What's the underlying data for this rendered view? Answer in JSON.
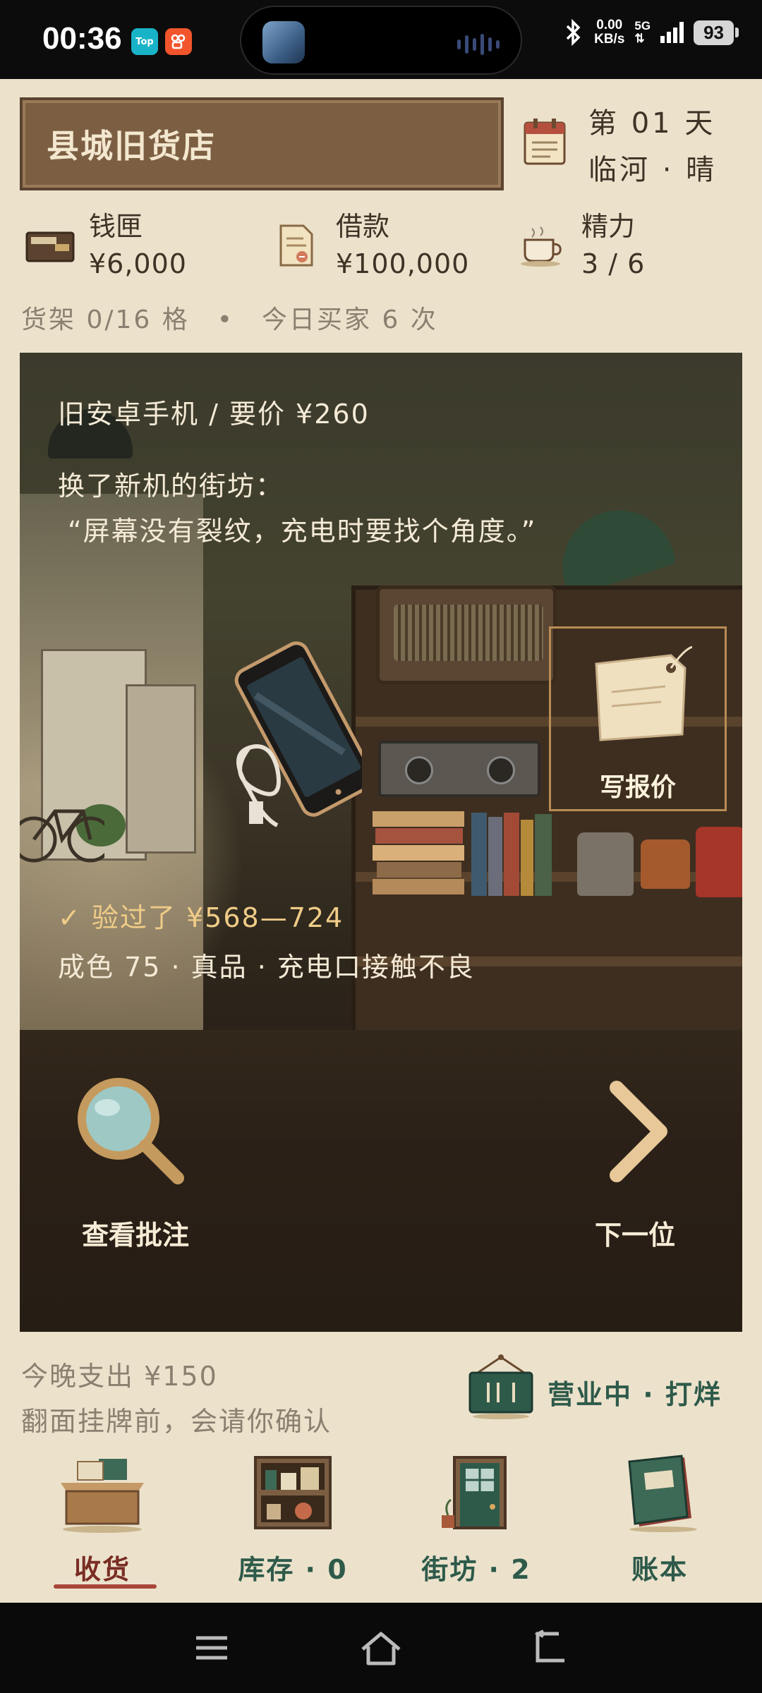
{
  "status_bar": {
    "time": "00:36",
    "app1_label": "Top",
    "net_speed": "0.00",
    "net_unit": "KB/s",
    "network": "5G",
    "battery": "93"
  },
  "header": {
    "shop_name": "县城旧货店",
    "day": "第 01 天",
    "location_weather": "临河 · 晴"
  },
  "stats": [
    {
      "label": "钱匣",
      "value": "¥6,000",
      "icon": "wallet-icon"
    },
    {
      "label": "借款",
      "value": "¥100,000",
      "icon": "loan-document-icon"
    },
    {
      "label": "精力",
      "value": "3 / 6",
      "icon": "coffee-cup-icon"
    }
  ],
  "shelf_info": "货架 0/16 格　•　今日买家 6 次",
  "scene": {
    "item_title": "旧安卓手机 / 要价 ¥260",
    "seller": "换了新机的街坊：",
    "quote": "“屏幕没有裂纹，充电时要找个角度。”",
    "quote_button": "写报价",
    "verified": "✓ 验过了 ¥568—724",
    "condition": "成色 75 · 真品 · 充电口接触不良"
  },
  "actions": {
    "inspect": "查看批注",
    "next": "下一位"
  },
  "footer": {
    "expense": "今晚支出 ¥150",
    "confirm_note": "翻面挂牌前，会请你确认",
    "shop_status": "营业中 · 打烊"
  },
  "nav": [
    {
      "label": "收货",
      "active": true
    },
    {
      "label": "库存 · 0",
      "active": false
    },
    {
      "label": "街坊 · 2",
      "active": false
    },
    {
      "label": "账本",
      "active": false
    }
  ],
  "colors": {
    "background": "#ece2cc",
    "sign_wood": "#7c5f43",
    "accent_green": "#2e5a4a",
    "active_red": "#a8463a",
    "price_gold": "#f0cc88"
  }
}
